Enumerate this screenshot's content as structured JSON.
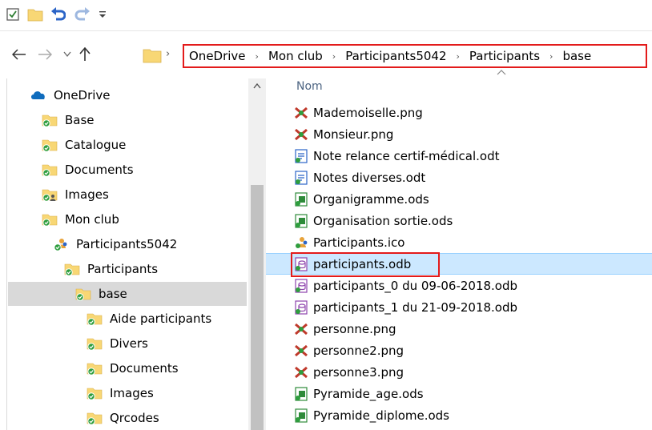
{
  "breadcrumb": [
    "OneDrive",
    "Mon club",
    "Participants5042",
    "Participants",
    "base"
  ],
  "tree": [
    {
      "label": "OneDrive",
      "icon": "onedrive-cloud-icon"
    },
    {
      "label": "Base",
      "icon": "synced-folder-icon"
    },
    {
      "label": "Catalogue",
      "icon": "synced-folder-icon"
    },
    {
      "label": "Documents",
      "icon": "synced-folder-icon"
    },
    {
      "label": "Images",
      "icon": "shared-folder-icon"
    },
    {
      "label": "Mon club",
      "icon": "synced-folder-icon"
    },
    {
      "label": "Participants5042",
      "icon": "participants-folder-icon"
    },
    {
      "label": "Participants",
      "icon": "synced-folder-icon"
    },
    {
      "label": "base",
      "icon": "synced-folder-icon",
      "selected": true
    },
    {
      "label": "Aide participants",
      "icon": "synced-folder-icon"
    },
    {
      "label": "Divers",
      "icon": "synced-folder-icon"
    },
    {
      "label": "Documents",
      "icon": "synced-folder-icon"
    },
    {
      "label": "Images",
      "icon": "synced-folder-icon"
    },
    {
      "label": "Qrcodes",
      "icon": "synced-folder-icon"
    }
  ],
  "list": {
    "column_name": "Nom",
    "files": [
      {
        "name": "Mademoiselle.png",
        "icon": "png-image-icon"
      },
      {
        "name": "Monsieur.png",
        "icon": "png-image-icon"
      },
      {
        "name": "Note relance certif-médical.odt",
        "icon": "odt-document-icon"
      },
      {
        "name": "Notes diverses.odt",
        "icon": "odt-document-icon"
      },
      {
        "name": "Organigramme.ods",
        "icon": "ods-spreadsheet-icon"
      },
      {
        "name": "Organisation sortie.ods",
        "icon": "ods-spreadsheet-icon"
      },
      {
        "name": "Participants.ico",
        "icon": "ico-file-icon"
      },
      {
        "name": "participants.odb",
        "icon": "odb-database-icon",
        "selected": true
      },
      {
        "name": "participants_0 du 09-06-2018.odb",
        "icon": "odb-database-icon"
      },
      {
        "name": "participants_1 du 21-09-2018.odb",
        "icon": "odb-database-icon"
      },
      {
        "name": "personne.png",
        "icon": "png-image-icon"
      },
      {
        "name": "personne2.png",
        "icon": "png-image-icon"
      },
      {
        "name": "personne3.png",
        "icon": "png-image-icon"
      },
      {
        "name": "Pyramide_age.ods",
        "icon": "ods-spreadsheet-icon"
      },
      {
        "name": "Pyramide_diplome.ods",
        "icon": "ods-spreadsheet-icon"
      }
    ]
  },
  "colors": {
    "highlight_border": "#e31b1b",
    "selection": "#cce8ff",
    "tree_selection": "#d9d9d9"
  }
}
